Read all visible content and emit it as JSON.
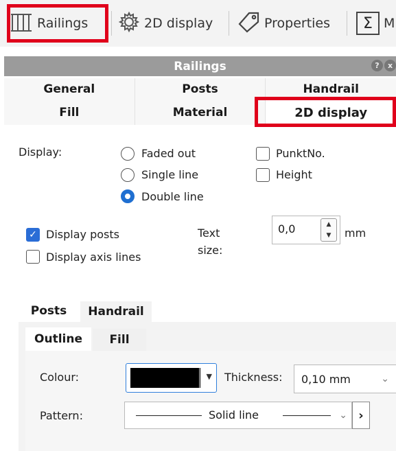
{
  "toolbar": {
    "railings_label": "Railings",
    "display2d_label": "2D display",
    "properties_label": "Properties",
    "sum_symbol": "Σ",
    "cut_label": "M"
  },
  "palette": {
    "title": "Railings",
    "help_glyph": "?",
    "close_glyph": "x"
  },
  "tabs": {
    "row1": [
      "General",
      "Posts",
      "Handrail"
    ],
    "row2": [
      "Fill",
      "Material",
      "2D display"
    ],
    "active": "2D display"
  },
  "display": {
    "label": "Display:",
    "options": [
      {
        "label": "Faded out",
        "selected": false
      },
      {
        "label": "Single line",
        "selected": false
      },
      {
        "label": "Double line",
        "selected": true
      }
    ],
    "checks": [
      {
        "label": "PunktNo.",
        "checked": false
      },
      {
        "label": "Height",
        "checked": false
      }
    ]
  },
  "posts_options": {
    "display_posts": {
      "label": "Display posts",
      "checked": true
    },
    "display_axis": {
      "label": "Display axis lines",
      "checked": false
    }
  },
  "text_size": {
    "label_line1": "Text",
    "label_line2": "size:",
    "value": "0,0",
    "unit": "mm"
  },
  "lower_tabs": [
    "Posts",
    "Handrail"
  ],
  "inner_tabs": [
    "Outline",
    "Fill"
  ],
  "outline": {
    "colour_label": "Colour:",
    "colour_value": "#000000",
    "thickness_label": "Thickness:",
    "thickness_value": "0,10 mm",
    "pattern_label": "Pattern:",
    "pattern_value": "Solid line"
  },
  "colors": {
    "highlight": "#e0001b",
    "accent": "#1f6fd1",
    "titlebar": "#9b9b9b"
  }
}
